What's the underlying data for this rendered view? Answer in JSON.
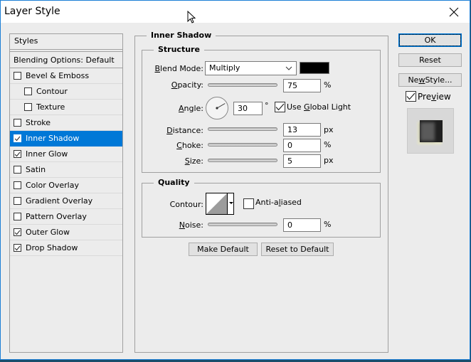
{
  "window": {
    "title": "Layer Style",
    "close_icon": "close-icon"
  },
  "sidebar": {
    "header": "Styles",
    "blending_options": "Blending Options: Default",
    "items": [
      {
        "label": "Bevel & Emboss",
        "checked": false,
        "indent": false,
        "selected": false
      },
      {
        "label": "Contour",
        "checked": false,
        "indent": true,
        "selected": false
      },
      {
        "label": "Texture",
        "checked": false,
        "indent": true,
        "selected": false
      },
      {
        "label": "Stroke",
        "checked": false,
        "indent": false,
        "selected": false
      },
      {
        "label": "Inner Shadow",
        "checked": true,
        "indent": false,
        "selected": true
      },
      {
        "label": "Inner Glow",
        "checked": true,
        "indent": false,
        "selected": false
      },
      {
        "label": "Satin",
        "checked": false,
        "indent": false,
        "selected": false
      },
      {
        "label": "Color Overlay",
        "checked": false,
        "indent": false,
        "selected": false
      },
      {
        "label": "Gradient Overlay",
        "checked": false,
        "indent": false,
        "selected": false
      },
      {
        "label": "Pattern Overlay",
        "checked": false,
        "indent": false,
        "selected": false
      },
      {
        "label": "Outer Glow",
        "checked": true,
        "indent": false,
        "selected": false
      },
      {
        "label": "Drop Shadow",
        "checked": true,
        "indent": false,
        "selected": false
      }
    ]
  },
  "panel": {
    "title": "Inner Shadow",
    "structure": {
      "title": "Structure",
      "blend_mode": {
        "label_u": "B",
        "label_rest": "lend Mode:",
        "value": "Multiply",
        "color": "#000000"
      },
      "opacity": {
        "label_u": "O",
        "label_rest": "pacity:",
        "value": "75",
        "unit": "%",
        "fraction": 0.75
      },
      "angle": {
        "label_u": "A",
        "label_rest": "ngle:",
        "value": "30",
        "unit": "°",
        "degrees": 30
      },
      "use_global_light": {
        "label_pre": "Use ",
        "label_u": "G",
        "label_rest": "lobal Light",
        "checked": true
      },
      "distance": {
        "label_u": "D",
        "label_rest": "istance:",
        "value": "13",
        "unit": "px",
        "fraction": 0.055
      },
      "choke": {
        "label_u": "C",
        "label_rest": "hoke:",
        "value": "0",
        "unit": "%",
        "fraction": 0.0
      },
      "size": {
        "label_u": "S",
        "label_rest": "ize:",
        "value": "5",
        "unit": "px",
        "fraction": 0.02
      }
    },
    "quality": {
      "title": "Quality",
      "contour_label": "Contour:",
      "anti_aliased": {
        "label_pre": "Anti-a",
        "label_u": "l",
        "label_rest": "iased",
        "checked": false
      },
      "noise": {
        "label_u": "N",
        "label_rest": "oise:",
        "value": "0",
        "unit": "%",
        "fraction": 0.0
      }
    },
    "make_default": "Make Default",
    "reset_to_default": "Reset to Default"
  },
  "actions": {
    "ok": "OK",
    "reset": "Reset",
    "new_style_pre": "Ne",
    "new_style_u": "w",
    "new_style_rest": " Style...",
    "preview_pre": "Pre",
    "preview_u": "v",
    "preview_rest": "iew",
    "preview_checked": true
  }
}
